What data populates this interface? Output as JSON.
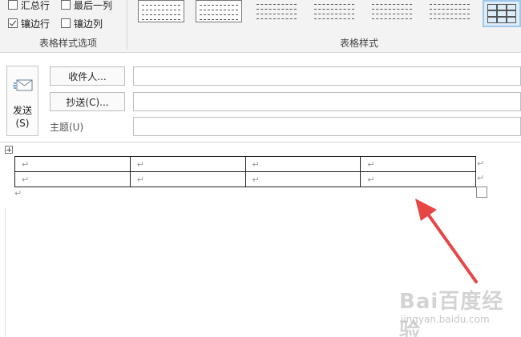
{
  "ribbon": {
    "options_group": {
      "label": "表格样式选项",
      "options": [
        {
          "label": "汇总行",
          "checked": false
        },
        {
          "label": "最后一列",
          "checked": false
        },
        {
          "label": "镶边行",
          "checked": true
        },
        {
          "label": "镶边列",
          "checked": false
        }
      ]
    },
    "styles_group": {
      "label": "表格样式",
      "selected_index": 6
    }
  },
  "compose": {
    "send_button": {
      "label": "发送",
      "shortcut": "(S)"
    },
    "to_button": "收件人...",
    "cc_button": "抄送(C)...",
    "subject_label": "主题(U)",
    "to_value": "",
    "cc_value": "",
    "subject_value": ""
  },
  "body": {
    "table": {
      "rows": [
        [
          "↵",
          "↵",
          "↵",
          "↵"
        ],
        [
          "↵",
          "↵",
          "↵",
          "↵"
        ]
      ]
    },
    "row_end_mark": "↵",
    "paragraph_mark": "↵"
  },
  "annotation": {
    "color": "#e64646"
  },
  "watermark": {
    "logo": "Bai百度经验",
    "url": "jingyan.baidu.com"
  }
}
